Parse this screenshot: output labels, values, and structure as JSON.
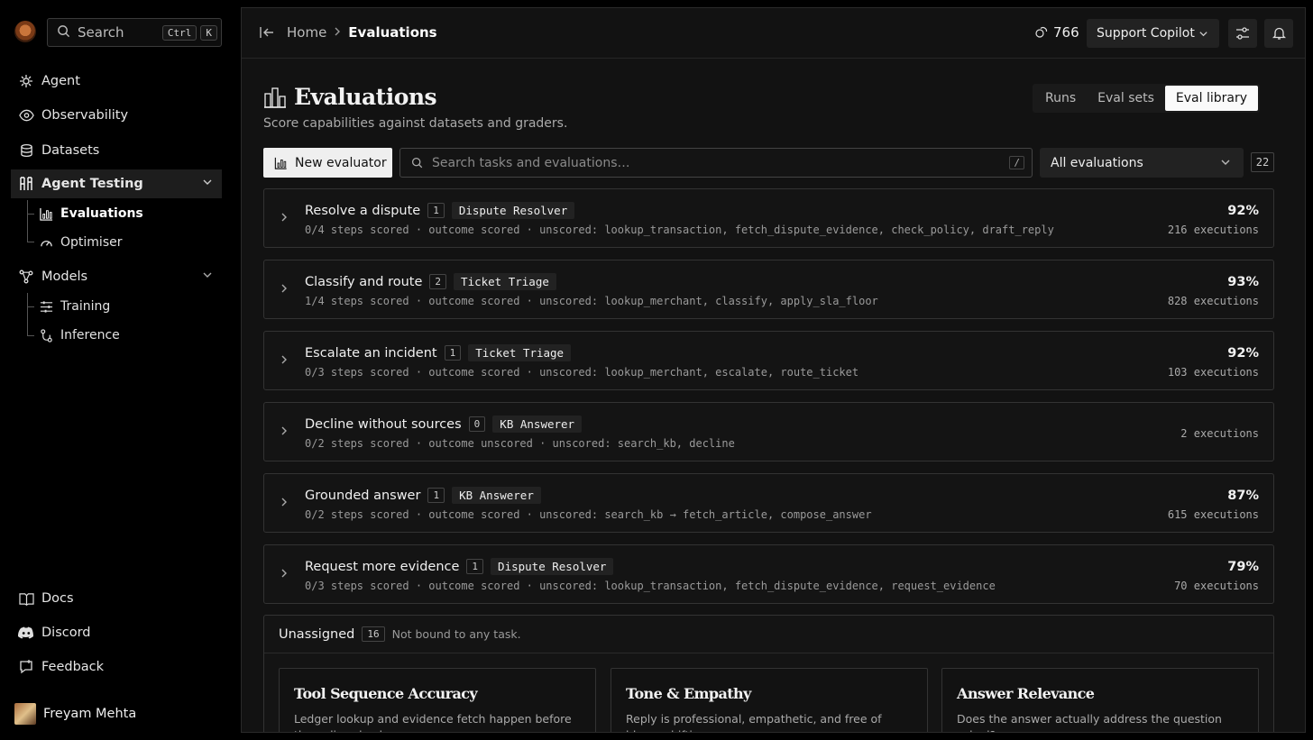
{
  "sidebar": {
    "search_label": "Search",
    "shortcut": [
      "Ctrl",
      "K"
    ],
    "nav": [
      {
        "label": "Agent"
      },
      {
        "label": "Observability"
      },
      {
        "label": "Datasets"
      },
      {
        "label": "Agent Testing"
      },
      {
        "label": "Models"
      }
    ],
    "testing_sub": [
      {
        "label": "Evaluations"
      },
      {
        "label": "Optimiser"
      }
    ],
    "models_sub": [
      {
        "label": "Training"
      },
      {
        "label": "Inference"
      }
    ],
    "footer": [
      {
        "label": "Docs"
      },
      {
        "label": "Discord"
      },
      {
        "label": "Feedback"
      }
    ],
    "user": "Freyam Mehta"
  },
  "header": {
    "crumb_home": "Home",
    "crumb_current": "Evaluations",
    "tokens": "766",
    "agent_selector": "Support Copilot"
  },
  "page": {
    "title": "Evaluations",
    "subtitle": "Score capabilities against datasets and graders.",
    "tabs": [
      "Runs",
      "Eval sets",
      "Eval library"
    ],
    "new_button": "New evaluator",
    "search_placeholder": "Search tasks and evaluations…",
    "search_shortcut": "/",
    "filter": "All evaluations",
    "count": "22"
  },
  "tasks": [
    {
      "name": "Resolve a dispute",
      "num": "1",
      "agent": "Dispute Resolver",
      "meta": "0/4 steps scored · outcome scored · unscored: lookup_transaction, fetch_dispute_evidence, check_policy, draft_reply",
      "pct": "92%",
      "exec": "216 executions"
    },
    {
      "name": "Classify and route",
      "num": "2",
      "agent": "Ticket Triage",
      "meta": "1/4 steps scored · outcome scored · unscored: lookup_merchant, classify, apply_sla_floor",
      "pct": "93%",
      "exec": "828 executions"
    },
    {
      "name": "Escalate an incident",
      "num": "1",
      "agent": "Ticket Triage",
      "meta": "0/3 steps scored · outcome scored · unscored: lookup_merchant, escalate, route_ticket",
      "pct": "92%",
      "exec": "103 executions"
    },
    {
      "name": "Decline without sources",
      "num": "0",
      "agent": "KB Answerer",
      "meta": "0/2 steps scored · outcome unscored · unscored: search_kb, decline",
      "pct": "",
      "exec": "2 executions"
    },
    {
      "name": "Grounded answer",
      "num": "1",
      "agent": "KB Answerer",
      "meta": "0/2 steps scored · outcome scored · unscored: search_kb → fetch_article, compose_answer",
      "pct": "87%",
      "exec": "615 executions"
    },
    {
      "name": "Request more evidence",
      "num": "1",
      "agent": "Dispute Resolver",
      "meta": "0/3 steps scored · outcome scored · unscored: lookup_transaction, fetch_dispute_evidence, request_evidence",
      "pct": "79%",
      "exec": "70 executions"
    }
  ],
  "unassigned": {
    "title": "Unassigned",
    "count": "16",
    "desc": "Not bound to any task.",
    "cards": [
      {
        "title": "Tool Sequence Accuracy",
        "desc": "Ledger lookup and evidence fetch happen before the policy check."
      },
      {
        "title": "Tone & Empathy",
        "desc": "Reply is professional, empathetic, and free of blame-shifting."
      },
      {
        "title": "Answer Relevance",
        "desc": "Does the answer actually address the question asked?"
      }
    ]
  }
}
